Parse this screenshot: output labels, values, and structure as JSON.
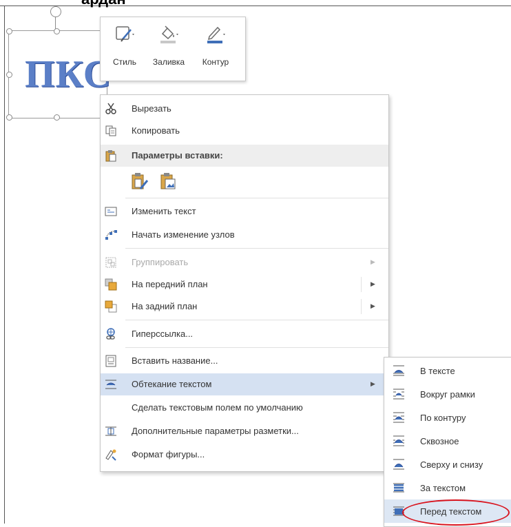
{
  "document": {
    "heading_fragment": "ардан",
    "wordart_text": "ПКС"
  },
  "mini_toolbar": {
    "buttons": [
      {
        "label": "Стиль",
        "icon": "shape-style-icon"
      },
      {
        "label": "Заливка",
        "icon": "fill-bucket-icon"
      },
      {
        "label": "Контур",
        "icon": "outline-pen-icon"
      }
    ]
  },
  "context_menu": {
    "items": [
      {
        "label": "Вырезать",
        "icon": "scissors-icon"
      },
      {
        "label": "Копировать",
        "icon": "copy-icon"
      },
      {
        "label": "Параметры вставки:",
        "icon": "paste-icon"
      },
      {
        "label": "Изменить текст",
        "icon": "edit-text-icon"
      },
      {
        "label": "Начать изменение узлов",
        "icon": "edit-points-icon"
      },
      {
        "label": "Группировать",
        "icon": "group-icon",
        "disabled": true
      },
      {
        "label": "На передний план",
        "icon": "bring-forward-icon"
      },
      {
        "label": "На задний план",
        "icon": "send-backward-icon"
      },
      {
        "label": "Гиперссылка...",
        "icon": "hyperlink-icon"
      },
      {
        "label": "Вставить название...",
        "icon": "insert-caption-icon"
      },
      {
        "label": "Обтекание текстом",
        "icon": "wrap-text-icon"
      },
      {
        "label": "Сделать текстовым полем по умолчанию",
        "icon": ""
      },
      {
        "label": "Дополнительные параметры разметки...",
        "icon": "layout-options-icon"
      },
      {
        "label": "Формат фигуры...",
        "icon": "format-shape-icon"
      }
    ]
  },
  "wrap_submenu": {
    "items": [
      {
        "label": "В тексте",
        "icon": "wrap-inline-icon"
      },
      {
        "label": "Вокруг рамки",
        "icon": "wrap-square-icon"
      },
      {
        "label": "По контуру",
        "icon": "wrap-tight-icon"
      },
      {
        "label": "Сквозное",
        "icon": "wrap-through-icon"
      },
      {
        "label": "Сверху и снизу",
        "icon": "wrap-top-bottom-icon"
      },
      {
        "label": "За текстом",
        "icon": "behind-text-icon"
      },
      {
        "label": "Перед текстом",
        "icon": "in-front-of-text-icon"
      }
    ]
  },
  "colors": {
    "accent_blue": "#4a78c2",
    "menu_highlight": "#d5e1f2",
    "annotation_red": "#d9141e"
  }
}
